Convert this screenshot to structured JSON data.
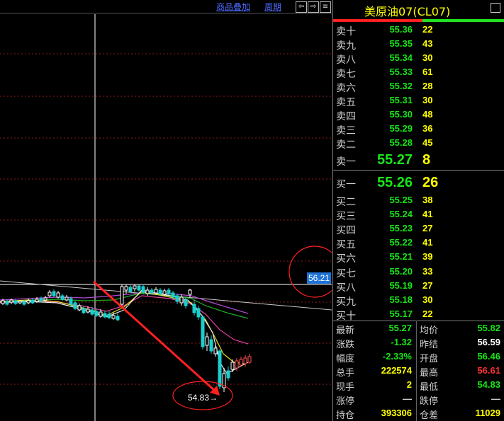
{
  "toolbar": {
    "overlay_label": "商品叠加",
    "period_label": "周期",
    "prev_label": "⇦",
    "next_label": "⇨",
    "more_label": "≡"
  },
  "panel": {
    "title": "美原油07(CL07)"
  },
  "asks": [
    {
      "label": "卖十",
      "price": "55.36",
      "volume": "22"
    },
    {
      "label": "卖九",
      "price": "55.35",
      "volume": "43"
    },
    {
      "label": "卖八",
      "price": "55.34",
      "volume": "30"
    },
    {
      "label": "卖七",
      "price": "55.33",
      "volume": "61"
    },
    {
      "label": "卖六",
      "price": "55.32",
      "volume": "28"
    },
    {
      "label": "卖五",
      "price": "55.31",
      "volume": "30"
    },
    {
      "label": "卖四",
      "price": "55.30",
      "volume": "48"
    },
    {
      "label": "卖三",
      "price": "55.29",
      "volume": "36"
    },
    {
      "label": "卖二",
      "price": "55.28",
      "volume": "45"
    },
    {
      "label": "卖一",
      "price": "55.27",
      "volume": "8"
    }
  ],
  "bids": [
    {
      "label": "买一",
      "price": "55.26",
      "volume": "26"
    },
    {
      "label": "买二",
      "price": "55.25",
      "volume": "38"
    },
    {
      "label": "买三",
      "price": "55.24",
      "volume": "41"
    },
    {
      "label": "买四",
      "price": "55.23",
      "volume": "27"
    },
    {
      "label": "买五",
      "price": "55.22",
      "volume": "41"
    },
    {
      "label": "买六",
      "price": "55.21",
      "volume": "39"
    },
    {
      "label": "买七",
      "price": "55.20",
      "volume": "33"
    },
    {
      "label": "买八",
      "price": "55.19",
      "volume": "27"
    },
    {
      "label": "买九",
      "price": "55.18",
      "volume": "30"
    },
    {
      "label": "买十",
      "price": "55.17",
      "volume": "22"
    }
  ],
  "stats_left": [
    {
      "label": "最新",
      "value": "55.27",
      "color": "#18e518"
    },
    {
      "label": "涨跌",
      "value": "-1.32",
      "color": "#18e518"
    },
    {
      "label": "幅度",
      "value": "-2.33%",
      "color": "#18e518"
    },
    {
      "label": "总手",
      "value": "222574",
      "color": "#ffff00"
    },
    {
      "label": "现手",
      "value": "2",
      "color": "#ffff00"
    },
    {
      "label": "涨停",
      "value": "—",
      "color": "#d0d0d0"
    },
    {
      "label": "持仓",
      "value": "393306",
      "color": "#ffff00"
    }
  ],
  "stats_right": [
    {
      "label": "均价",
      "value": "55.82",
      "color": "#18e518"
    },
    {
      "label": "昨结",
      "value": "56.59",
      "color": "#ffffff"
    },
    {
      "label": "开盘",
      "value": "56.46",
      "color": "#18e518"
    },
    {
      "label": "最高",
      "value": "56.61",
      "color": "#ff3030"
    },
    {
      "label": "最低",
      "value": "54.83",
      "color": "#18e518"
    },
    {
      "label": "跌停",
      "value": "—",
      "color": "#d0d0d0"
    },
    {
      "label": "仓差",
      "value": "11029",
      "color": "#ffff00"
    }
  ],
  "chart": {
    "current_price_tag": "56.21",
    "low_label": "54.83→"
  }
}
